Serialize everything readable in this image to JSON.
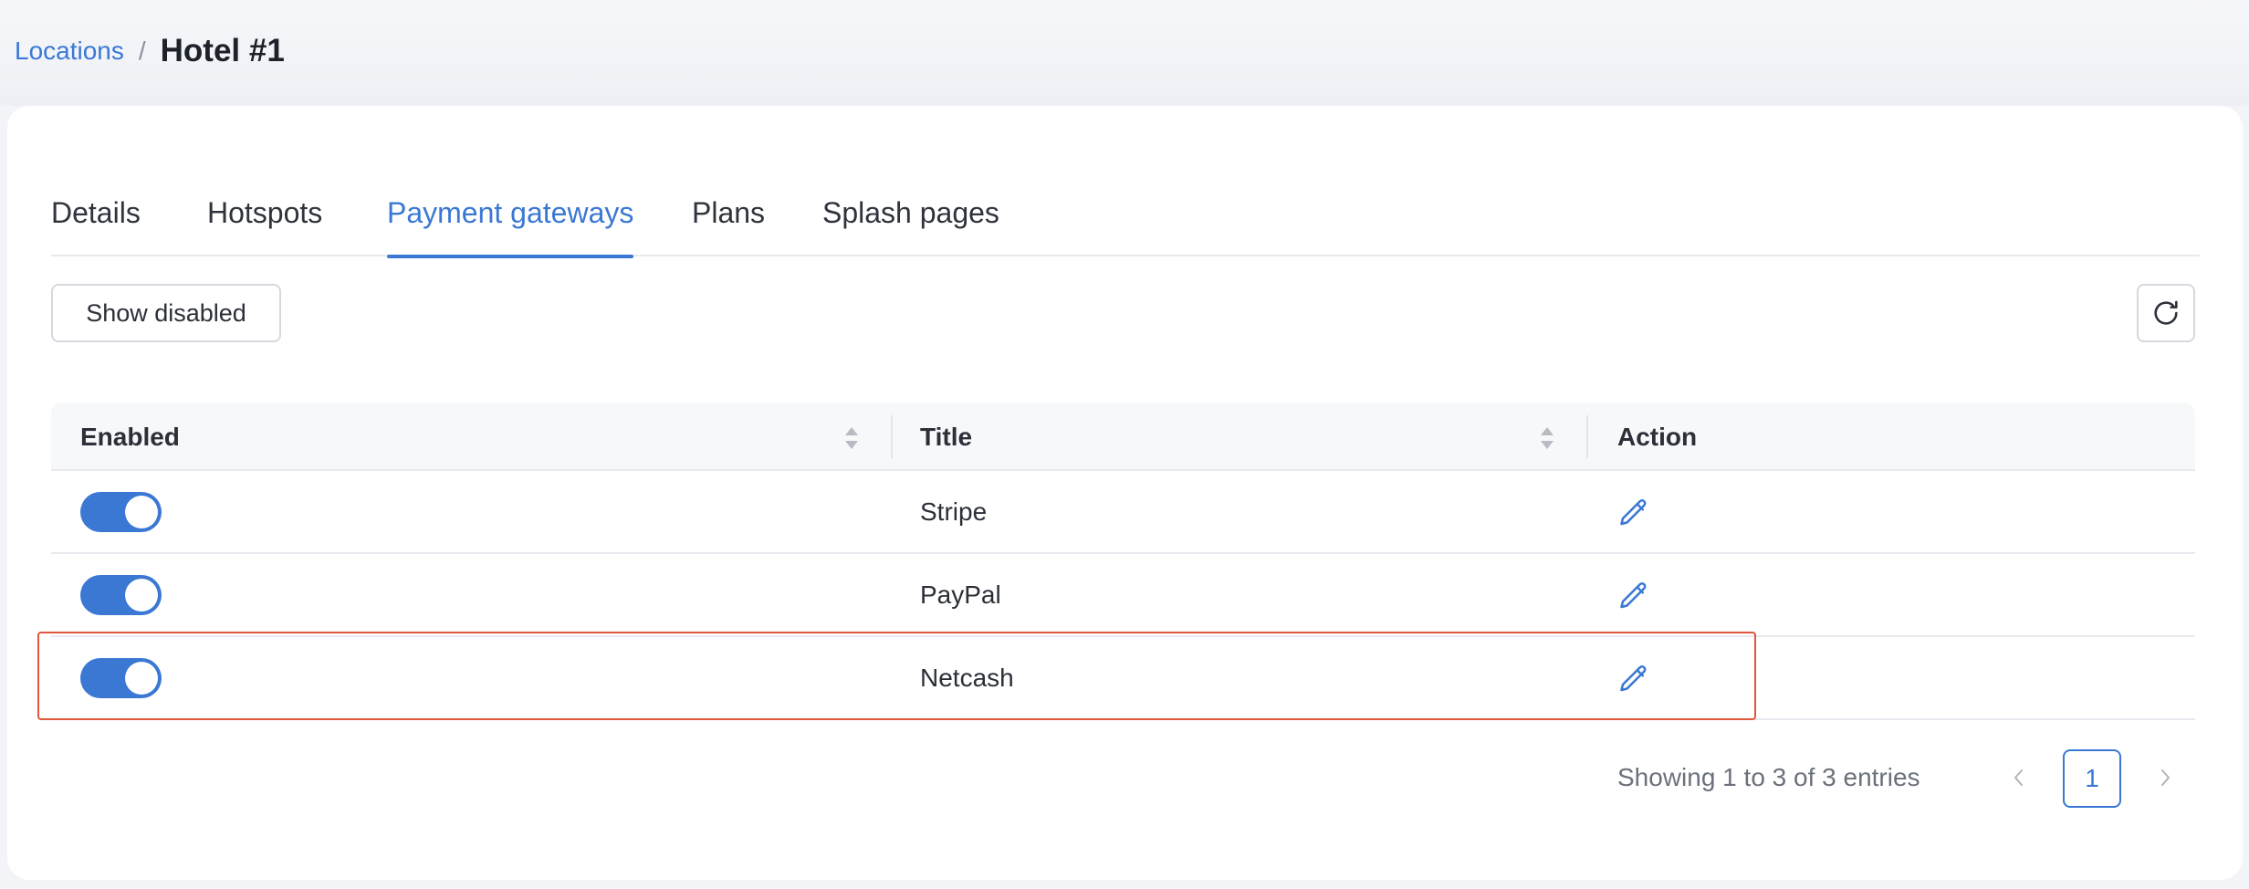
{
  "breadcrumb": {
    "parent": "Locations",
    "separator": "/",
    "current": "Hotel #1"
  },
  "tabs": [
    {
      "label": "Details",
      "active": false
    },
    {
      "label": "Hotspots",
      "active": false
    },
    {
      "label": "Payment gateways",
      "active": true
    },
    {
      "label": "Plans",
      "active": false
    },
    {
      "label": "Splash pages",
      "active": false
    }
  ],
  "toolbar": {
    "show_disabled_label": "Show disabled",
    "refresh_icon": "refresh-icon"
  },
  "table": {
    "columns": [
      {
        "label": "Enabled",
        "sortable": true
      },
      {
        "label": "Title",
        "sortable": true
      },
      {
        "label": "Action",
        "sortable": false
      }
    ],
    "rows": [
      {
        "enabled": true,
        "title": "Stripe",
        "action_icon": "pencil-icon"
      },
      {
        "enabled": true,
        "title": "PayPal",
        "action_icon": "pencil-icon"
      },
      {
        "enabled": true,
        "title": "Netcash",
        "action_icon": "pencil-icon",
        "highlighted": true
      }
    ]
  },
  "pagination": {
    "info": "Showing 1 to 3 of 3 entries",
    "current_page": "1"
  },
  "colors": {
    "accent": "#3a78d4",
    "highlight_border": "#e2553c",
    "text": "#2b2f38",
    "muted": "#6b717c"
  }
}
